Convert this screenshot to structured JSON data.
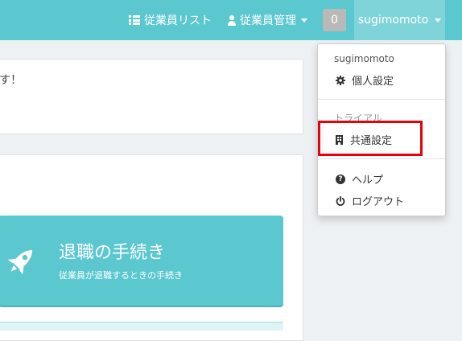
{
  "navbar": {
    "employee_list": "従業員リスト",
    "employee_manage": "従業員管理",
    "badge_count": "0",
    "username": "sugimomoto"
  },
  "main": {
    "top_message": "す！",
    "card": {
      "title": "退職の手続き",
      "subtitle": "従業員が退職するときの手続き"
    }
  },
  "dropdown": {
    "header_user": "sugimomoto",
    "personal_settings": "個人設定",
    "header_trial": "トライアル",
    "shared_settings": "共通設定",
    "help": "ヘルプ",
    "logout": "ログアウト"
  },
  "colors": {
    "brand": "#5bc7cf",
    "highlight": "#e8000b"
  },
  "icons": {
    "list": "list-icon",
    "user": "user-icon",
    "gear": "gear-icon",
    "building": "building-icon",
    "help": "help-icon",
    "power": "power-icon",
    "rocket": "rocket-icon"
  }
}
